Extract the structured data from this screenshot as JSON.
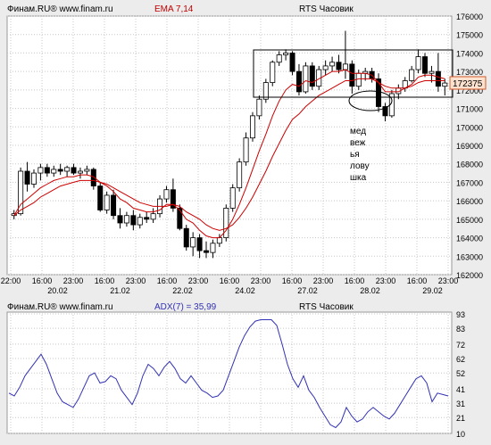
{
  "colors": {
    "background": "#ececec",
    "plot_bg": "#ffffff",
    "grid": "#c8c8c8",
    "candle": "#000000",
    "ema_fast": "#cc0000",
    "ema_slow": "#cc0000",
    "adx_line": "#3232b4",
    "header_red": "#c00000",
    "price_tag_fill": "#fde2cf",
    "price_tag_border": "#d05a28"
  },
  "top_header": {
    "source": "Финам.RU® www.finam.ru",
    "indicator": "EMA 7,14",
    "instrument": "RTS Часовик"
  },
  "bottom_header": {
    "source": "Финам.RU® www.finam.ru",
    "indicator": "ADX(7) = 35,99",
    "instrument": "RTS Часовик"
  },
  "annotation": {
    "lines": [
      "мед",
      "веж",
      "ья",
      "лову",
      "шка"
    ]
  },
  "last_price_label": "172375",
  "chart_data": [
    {
      "type": "candlestick",
      "title": "RTS Часовик",
      "series": [
        {
          "name": "EMA 7"
        },
        {
          "name": "EMA 14"
        }
      ],
      "ylim": [
        162000,
        176000
      ],
      "y_ticks": [
        "176000",
        "175000",
        "174000",
        "173000",
        "172000",
        "171000",
        "170000",
        "169000",
        "168000",
        "167000",
        "166000",
        "165000",
        "164000",
        "163000",
        "162000"
      ],
      "x_ticks": [
        "22:00",
        "16:00",
        "23:00",
        "16:00",
        "23:00",
        "16:00",
        "23:00",
        "16:00",
        "23:00",
        "16:00",
        "23:00",
        "16:00",
        "23:00",
        "16:00",
        "23:00"
      ],
      "date_labels": [
        "20.02",
        "21.02",
        "22.02",
        "24.02",
        "27.02",
        "28.02",
        "29.02"
      ],
      "last_price": 172375,
      "candles": [
        [
          165200,
          165500,
          165000,
          165300
        ],
        [
          165300,
          167800,
          165200,
          167600
        ],
        [
          167600,
          168100,
          166500,
          166900
        ],
        [
          166900,
          167700,
          166700,
          167500
        ],
        [
          167500,
          168000,
          167100,
          167800
        ],
        [
          167800,
          168000,
          167300,
          167500
        ],
        [
          167500,
          167900,
          167300,
          167700
        ],
        [
          167700,
          168000,
          167400,
          167600
        ],
        [
          167600,
          167900,
          167300,
          167800
        ],
        [
          167800,
          168000,
          167400,
          167500
        ],
        [
          167500,
          167800,
          167200,
          167600
        ],
        [
          167600,
          167900,
          167400,
          167700
        ],
        [
          167700,
          167800,
          166600,
          166800
        ],
        [
          166800,
          167000,
          165400,
          165500
        ],
        [
          165500,
          166500,
          165300,
          166300
        ],
        [
          166300,
          166600,
          165000,
          165200
        ],
        [
          165200,
          165600,
          164500,
          164800
        ],
        [
          164800,
          165400,
          164600,
          165200
        ],
        [
          165200,
          165500,
          164400,
          164700
        ],
        [
          164700,
          165300,
          164500,
          165100
        ],
        [
          165100,
          165400,
          164800,
          165000
        ],
        [
          165000,
          165600,
          164800,
          165300
        ],
        [
          165300,
          166300,
          165100,
          166100
        ],
        [
          166100,
          166800,
          165900,
          166600
        ],
        [
          166600,
          167200,
          165400,
          165600
        ],
        [
          165600,
          165800,
          164400,
          164500
        ],
        [
          164500,
          164700,
          163300,
          163500
        ],
        [
          163500,
          164300,
          163000,
          164000
        ],
        [
          164000,
          164200,
          162900,
          163300
        ],
        [
          163300,
          163800,
          162900,
          163200
        ],
        [
          163200,
          163900,
          162900,
          163700
        ],
        [
          163700,
          164200,
          163500,
          164000
        ],
        [
          164000,
          165800,
          163800,
          165600
        ],
        [
          165600,
          166900,
          165400,
          166700
        ],
        [
          166700,
          168300,
          166500,
          168100
        ],
        [
          168100,
          169700,
          167900,
          169400
        ],
        [
          169400,
          170800,
          169200,
          170600
        ],
        [
          170600,
          171700,
          170400,
          171500
        ],
        [
          171500,
          172600,
          171300,
          172400
        ],
        [
          172400,
          173600,
          172200,
          173500
        ],
        [
          173500,
          174100,
          173300,
          173900
        ],
        [
          173900,
          174200,
          173600,
          174000
        ],
        [
          174000,
          174100,
          172800,
          173000
        ],
        [
          173000,
          173400,
          171700,
          171900
        ],
        [
          171900,
          173500,
          171800,
          173300
        ],
        [
          173300,
          173500,
          172000,
          172200
        ],
        [
          172200,
          173300,
          172000,
          173100
        ],
        [
          173100,
          173600,
          172800,
          173300
        ],
        [
          173300,
          173800,
          173000,
          173500
        ],
        [
          173500,
          173900,
          172900,
          173100
        ],
        [
          173100,
          175200,
          172600,
          173400
        ],
        [
          173400,
          173600,
          171800,
          172200
        ],
        [
          172200,
          173100,
          172000,
          172900
        ],
        [
          172900,
          173200,
          172500,
          173000
        ],
        [
          173000,
          173200,
          172400,
          172600
        ],
        [
          172600,
          172900,
          170800,
          171100
        ],
        [
          171100,
          171300,
          170300,
          170600
        ],
        [
          170600,
          172000,
          170500,
          171800
        ],
        [
          171800,
          172300,
          171500,
          172100
        ],
        [
          172100,
          172700,
          171900,
          172500
        ],
        [
          172500,
          173300,
          172400,
          173100
        ],
        [
          173100,
          174200,
          172900,
          173800
        ],
        [
          173800,
          174000,
          172700,
          172900
        ],
        [
          172900,
          173300,
          172400,
          173000
        ],
        [
          173000,
          174000,
          171900,
          172200
        ],
        [
          172200,
          172600,
          171700,
          172375
        ]
      ],
      "ema_fast": [
        165200,
        165800,
        166100,
        166400,
        166700,
        166900,
        167100,
        167200,
        167300,
        167300,
        167400,
        167400,
        167300,
        167000,
        166800,
        166500,
        166100,
        165900,
        165600,
        165500,
        165400,
        165400,
        165500,
        165800,
        165800,
        165500,
        165000,
        164800,
        164400,
        164100,
        164000,
        164000,
        164400,
        165000,
        165800,
        166700,
        167700,
        168700,
        169600,
        170600,
        171400,
        172000,
        172300,
        172200,
        172500,
        172400,
        172600,
        172800,
        173000,
        173000,
        173100,
        172900,
        172900,
        172900,
        172800,
        172400,
        171900,
        171900,
        171900,
        172100,
        172300,
        172700,
        172800,
        172800,
        172700,
        172600
      ],
      "ema_slow": [
        165200,
        165500,
        165700,
        165900,
        166200,
        166400,
        166600,
        166800,
        166900,
        167000,
        167100,
        167100,
        167100,
        167000,
        166900,
        166700,
        166500,
        166300,
        166100,
        165900,
        165800,
        165700,
        165700,
        165700,
        165800,
        165700,
        165400,
        165200,
        165000,
        164700,
        164500,
        164400,
        164500,
        164700,
        165100,
        165600,
        166200,
        166900,
        167600,
        168400,
        169100,
        169800,
        170400,
        170700,
        171100,
        171400,
        171700,
        171900,
        172100,
        172300,
        172500,
        172500,
        172600,
        172600,
        172600,
        172400,
        172200,
        172100,
        172100,
        172100,
        172200,
        172400,
        172500,
        172500,
        172500,
        172500
      ]
    },
    {
      "type": "line",
      "title": "ADX(7)",
      "series": [
        {
          "name": "ADX(7) = 35,99"
        }
      ],
      "ylim": [
        10,
        93
      ],
      "y_ticks": [
        "93",
        "83",
        "72",
        "62",
        "52",
        "41",
        "31",
        "21",
        "10"
      ],
      "values": [
        38,
        36,
        42,
        50,
        55,
        60,
        65,
        58,
        48,
        38,
        32,
        30,
        28,
        34,
        42,
        50,
        52,
        45,
        46,
        50,
        48,
        40,
        35,
        30,
        38,
        50,
        58,
        55,
        50,
        56,
        60,
        55,
        48,
        45,
        50,
        45,
        40,
        38,
        35,
        36,
        40,
        50,
        60,
        70,
        78,
        84,
        88,
        89,
        89,
        89,
        85,
        72,
        58,
        48,
        42,
        50,
        40,
        35,
        28,
        22,
        16,
        14,
        18,
        28,
        22,
        18,
        20,
        25,
        28,
        25,
        22,
        20,
        24,
        30,
        36,
        42,
        48,
        50,
        45,
        32,
        38,
        37,
        35.99
      ]
    }
  ]
}
